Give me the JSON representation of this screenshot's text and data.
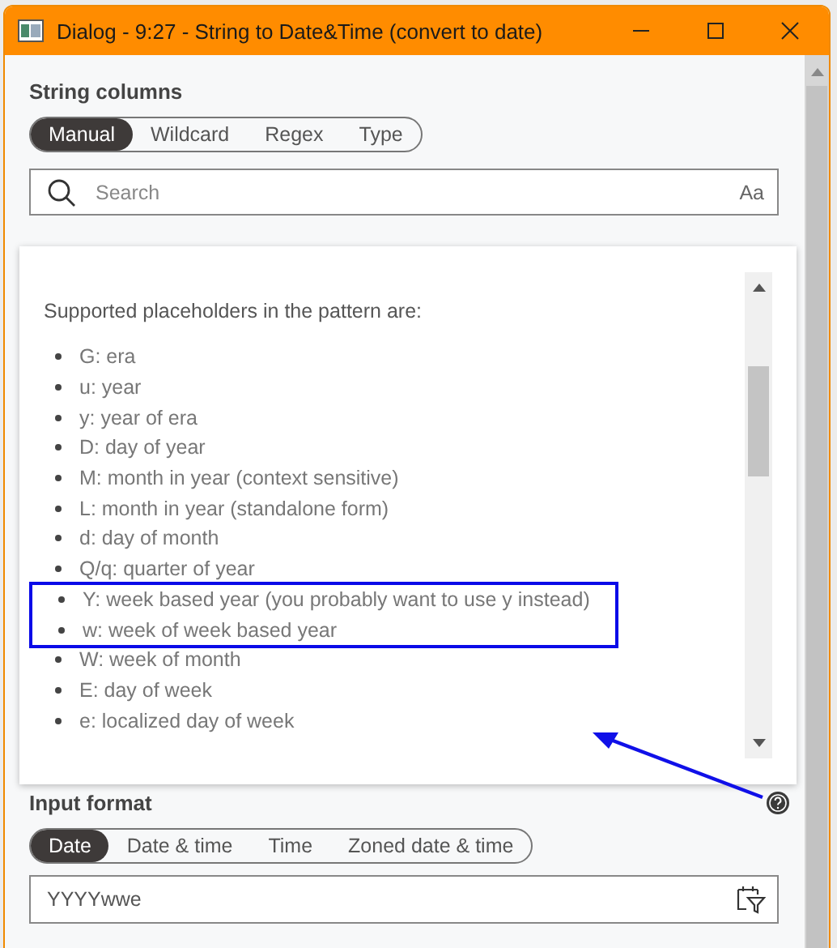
{
  "window": {
    "title": "Dialog - 9:27 - String to Date&Time (convert to date)"
  },
  "string_columns": {
    "heading": "String columns",
    "tabs": [
      {
        "label": "Manual",
        "selected": true
      },
      {
        "label": "Wildcard",
        "selected": false
      },
      {
        "label": "Regex",
        "selected": false
      },
      {
        "label": "Type",
        "selected": false
      }
    ],
    "search": {
      "placeholder": "Search",
      "case_toggle": "Aa"
    }
  },
  "help_popup": {
    "intro": "Supported placeholders in the pattern are:",
    "groups": [
      {
        "highlighted": false,
        "items": [
          "G: era",
          "u: year",
          "y: year of era",
          "D: day of year",
          "M: month in year (context sensitive)",
          "L: month in year (standalone form)",
          "d: day of month",
          "Q/q: quarter of year"
        ]
      },
      {
        "highlighted": true,
        "items": [
          "Y: week based year (you probably want to use y instead)",
          "w: week of week based year"
        ]
      },
      {
        "highlighted": false,
        "items": [
          "W: week of month",
          "E: day of week",
          "e: localized day of week"
        ]
      }
    ]
  },
  "input_format": {
    "heading": "Input format",
    "tabs": [
      {
        "label": "Date",
        "selected": true
      },
      {
        "label": "Date & time",
        "selected": false
      },
      {
        "label": "Time",
        "selected": false
      },
      {
        "label": "Zoned date & time",
        "selected": false
      }
    ],
    "value": "YYYYwwe"
  }
}
